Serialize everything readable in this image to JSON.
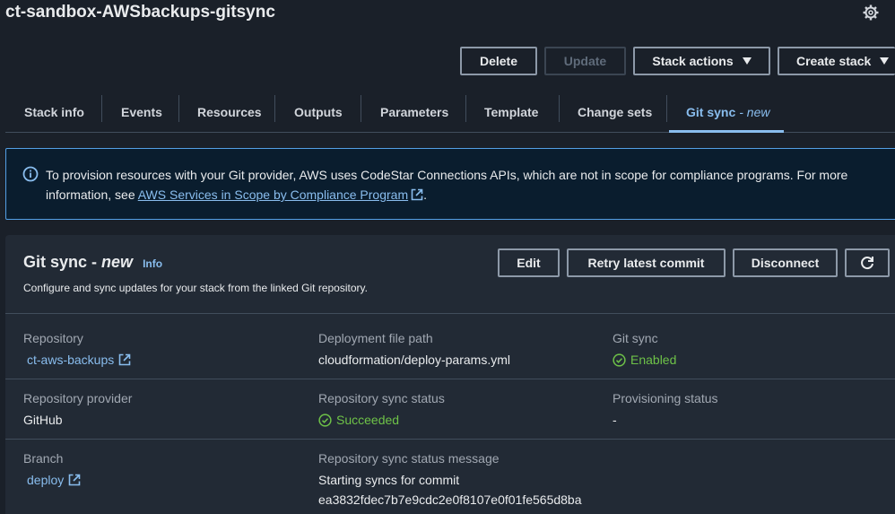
{
  "header": {
    "title": "ct-sandbox-AWSbackups-gitsync",
    "settings_icon": "gear-icon"
  },
  "actions": {
    "delete": "Delete",
    "update": "Update",
    "stack_actions": "Stack actions",
    "create_stack": "Create stack"
  },
  "tabs": [
    {
      "label": "Stack info"
    },
    {
      "label": "Events"
    },
    {
      "label": "Resources"
    },
    {
      "label": "Outputs"
    },
    {
      "label": "Parameters"
    },
    {
      "label": "Template"
    },
    {
      "label": "Change sets"
    },
    {
      "label": "Git sync",
      "suffix": "- new",
      "active": true
    }
  ],
  "alert": {
    "text_before": "To provision resources with your Git provider, AWS uses CodeStar Connections APIs, which are not in scope for compliance programs. For more information, see ",
    "link": "AWS Services in Scope by Compliance Program",
    "text_after": "."
  },
  "panel": {
    "title": "Git sync -",
    "title_em": "new",
    "info": "Info",
    "description": "Configure and sync updates for your stack from the linked Git repository.",
    "buttons": {
      "edit": "Edit",
      "retry": "Retry latest commit",
      "disconnect": "Disconnect"
    },
    "fields": {
      "repository": {
        "label": "Repository",
        "value": "ct-aws-backups"
      },
      "deployment_file": {
        "label": "Deployment file path",
        "value": "cloudformation/deploy-params.yml"
      },
      "git_sync": {
        "label": "Git sync",
        "value": "Enabled"
      },
      "repo_provider": {
        "label": "Repository provider",
        "value": "GitHub"
      },
      "repo_sync_status": {
        "label": "Repository sync status",
        "value": "Succeeded"
      },
      "provisioning_status": {
        "label": "Provisioning status",
        "value": "-"
      },
      "branch": {
        "label": "Branch",
        "value": "deploy"
      },
      "repo_sync_message": {
        "label": "Repository sync status message",
        "line1": "Starting syncs for commit",
        "line2": "ea3832fdec7b7e9cdc2e0f8107e0f01fe565d8ba"
      }
    }
  },
  "colors": {
    "background": "#1a2029",
    "panel": "#222a35",
    "accent_link": "#89bdee",
    "success": "#6ec248",
    "alert_border": "#539fe5"
  }
}
